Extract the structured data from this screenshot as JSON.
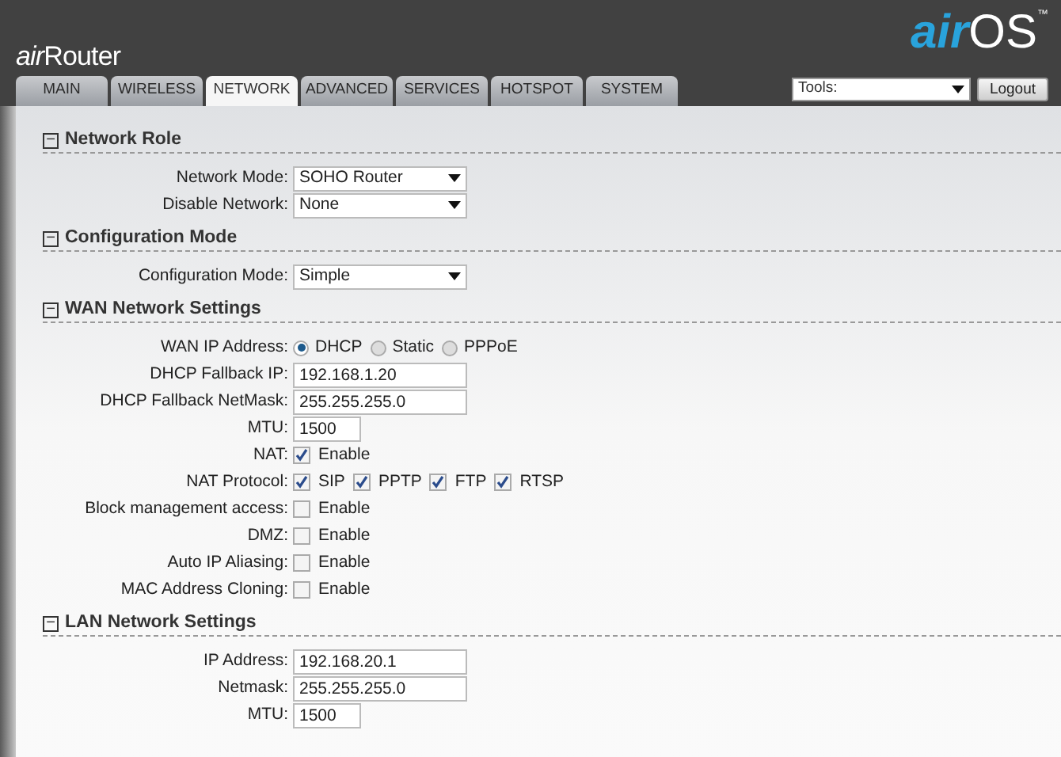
{
  "header": {
    "product": {
      "prefix": "air",
      "name": "Router"
    },
    "brand": {
      "prefix": "air",
      "name": "OS",
      "mark": "™"
    }
  },
  "tabs": [
    {
      "label": "MAIN",
      "selected": false
    },
    {
      "label": "WIRELESS",
      "selected": false
    },
    {
      "label": "NETWORK",
      "selected": true
    },
    {
      "label": "ADVANCED",
      "selected": false
    },
    {
      "label": "SERVICES",
      "selected": false
    },
    {
      "label": "HOTSPOT",
      "selected": false
    },
    {
      "label": "SYSTEM",
      "selected": false
    }
  ],
  "tools": {
    "value": "Tools:"
  },
  "logout": "Logout",
  "sections": [
    {
      "toggle": "−",
      "title": "Network Role",
      "rows": [
        {
          "kind": "select",
          "label": "Network Mode:",
          "value": "SOHO Router"
        },
        {
          "kind": "select",
          "label": "Disable Network:",
          "value": "None"
        }
      ]
    },
    {
      "toggle": "−",
      "title": "Configuration Mode",
      "rows": [
        {
          "kind": "select",
          "label": "Configuration Mode:",
          "value": "Simple"
        }
      ]
    },
    {
      "toggle": "−",
      "title": "WAN Network Settings",
      "rows": [
        {
          "kind": "radio",
          "label": "WAN IP Address:",
          "options": [
            {
              "label": "DHCP",
              "selected": true
            },
            {
              "label": "Static",
              "selected": false
            },
            {
              "label": "PPPoE",
              "selected": false
            }
          ]
        },
        {
          "kind": "text",
          "label": "DHCP Fallback IP:",
          "value": "192.168.1.20"
        },
        {
          "kind": "text",
          "label": "DHCP Fallback NetMask:",
          "value": "255.255.255.0"
        },
        {
          "kind": "short",
          "label": "MTU:",
          "value": "1500"
        },
        {
          "kind": "check",
          "label": "NAT:",
          "options": [
            {
              "label": "Enable",
              "checked": true
            }
          ]
        },
        {
          "kind": "check",
          "label": "NAT Protocol:",
          "options": [
            {
              "label": "SIP",
              "checked": true
            },
            {
              "label": "PPTP",
              "checked": true
            },
            {
              "label": "FTP",
              "checked": true
            },
            {
              "label": "RTSP",
              "checked": true
            }
          ]
        },
        {
          "kind": "check",
          "label": "Block management access:",
          "options": [
            {
              "label": "Enable",
              "checked": false
            }
          ]
        },
        {
          "kind": "check",
          "label": "DMZ:",
          "options": [
            {
              "label": "Enable",
              "checked": false
            }
          ]
        },
        {
          "kind": "check",
          "label": "Auto IP Aliasing:",
          "options": [
            {
              "label": "Enable",
              "checked": false
            }
          ]
        },
        {
          "kind": "check",
          "label": "MAC Address Cloning:",
          "options": [
            {
              "label": "Enable",
              "checked": false
            }
          ]
        }
      ]
    },
    {
      "toggle": "−",
      "title": "LAN Network Settings",
      "rows": [
        {
          "kind": "text",
          "label": "IP Address:",
          "value": "192.168.20.1"
        },
        {
          "kind": "text",
          "label": "Netmask:",
          "value": "255.255.255.0"
        },
        {
          "kind": "short",
          "label": "MTU:",
          "value": "1500"
        }
      ]
    }
  ]
}
